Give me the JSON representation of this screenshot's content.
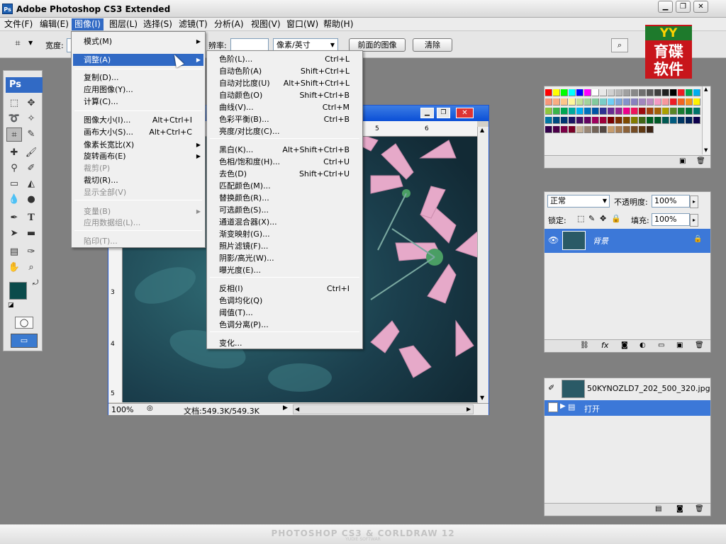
{
  "app": {
    "title": "Adobe Photoshop CS3 Extended",
    "icon_label": "Ps"
  },
  "menubar": [
    {
      "label": "文件(F)"
    },
    {
      "label": "编辑(E)"
    },
    {
      "label": "图像(I)"
    },
    {
      "label": "图层(L)"
    },
    {
      "label": "选择(S)"
    },
    {
      "label": "滤镜(T)"
    },
    {
      "label": "分析(A)"
    },
    {
      "label": "视图(V)"
    },
    {
      "label": "窗口(W)"
    },
    {
      "label": "帮助(H)"
    }
  ],
  "options_bar": {
    "width_label": "宽度:",
    "resolution_label": "辨率:",
    "resolution_unit": "像素/英寸",
    "front_image_button": "前面的图像",
    "clear_button": "清除"
  },
  "logo": {
    "text": "育碟软件",
    "mark": "YY"
  },
  "toolbox": {
    "badge": "Ps",
    "fg_color": "#0b4b4b",
    "bg_color": "#000000"
  },
  "image_menu": {
    "items": [
      {
        "label": "模式(M)",
        "submenu": true
      },
      {
        "label": "调整(A)",
        "submenu": true,
        "highlighted": true
      },
      {
        "label": "复制(D)..."
      },
      {
        "label": "应用图像(Y)..."
      },
      {
        "label": "计算(C)..."
      },
      {
        "label": "图像大小(I)...",
        "shortcut": "Alt+Ctrl+I"
      },
      {
        "label": "画布大小(S)...",
        "shortcut": "Alt+Ctrl+C"
      },
      {
        "label": "像素长宽比(X)",
        "submenu": true
      },
      {
        "label": "旋转画布(E)",
        "submenu": true
      },
      {
        "label": "裁剪(P)",
        "disabled": true
      },
      {
        "label": "裁切(R)..."
      },
      {
        "label": "显示全部(V)",
        "disabled": true
      },
      {
        "label": "变量(B)",
        "submenu": true,
        "disabled": true
      },
      {
        "label": "应用数据组(L)...",
        "disabled": true
      },
      {
        "label": "陷印(T)...",
        "disabled": true
      }
    ]
  },
  "adjust_menu": {
    "items": [
      {
        "label": "色阶(L)...",
        "shortcut": "Ctrl+L"
      },
      {
        "label": "自动色阶(A)",
        "shortcut": "Shift+Ctrl+L"
      },
      {
        "label": "自动对比度(U)",
        "shortcut": "Alt+Shift+Ctrl+L"
      },
      {
        "label": "自动颜色(O)",
        "shortcut": "Shift+Ctrl+B"
      },
      {
        "label": "曲线(V)...",
        "shortcut": "Ctrl+M"
      },
      {
        "label": "色彩平衡(B)...",
        "shortcut": "Ctrl+B"
      },
      {
        "label": "亮度/对比度(C)..."
      },
      {
        "label": "黑白(K)...",
        "shortcut": "Alt+Shift+Ctrl+B"
      },
      {
        "label": "色相/饱和度(H)...",
        "shortcut": "Ctrl+U"
      },
      {
        "label": "去色(D)",
        "shortcut": "Shift+Ctrl+U"
      },
      {
        "label": "匹配颜色(M)..."
      },
      {
        "label": "替换颜色(R)..."
      },
      {
        "label": "可选颜色(S)..."
      },
      {
        "label": "通道混合器(X)..."
      },
      {
        "label": "渐变映射(G)..."
      },
      {
        "label": "照片滤镜(F)..."
      },
      {
        "label": "阴影/高光(W)..."
      },
      {
        "label": "曝光度(E)..."
      },
      {
        "label": "反相(I)",
        "shortcut": "Ctrl+I"
      },
      {
        "label": "色调均化(Q)"
      },
      {
        "label": "阈值(T)..."
      },
      {
        "label": "色调分离(P)..."
      },
      {
        "label": "变化..."
      }
    ]
  },
  "document": {
    "zoom": "100%",
    "status": "文档:549.3K/549.3K",
    "ruler_top": [
      "5",
      "6"
    ],
    "ruler_left": [
      "3",
      "4",
      "5"
    ]
  },
  "layers_panel": {
    "blend_mode": "正常",
    "opacity_label": "不透明度:",
    "opacity_value": "100%",
    "lock_label": "锁定:",
    "fill_label": "填充:",
    "fill_value": "100%",
    "layer_name": "背景"
  },
  "history_panel": {
    "snapshot_name": "50KYNOZLD7_202_500_320.jpg",
    "step_name": "打开"
  },
  "footer": {
    "text": "PHOTOSHOP CS3 & CORLDRAW 12",
    "sub": "YUDIE SOFTWAR"
  },
  "swatch_colors": [
    "#ff0000",
    "#ffff00",
    "#00ff00",
    "#00ffff",
    "#0000ff",
    "#ff00ff",
    "#ffffff",
    "#e8e8e8",
    "#d0d0d0",
    "#b8b8b8",
    "#a0a0a0",
    "#888888",
    "#707070",
    "#585858",
    "#404040",
    "#202020",
    "#000000",
    "#ec1c24",
    "#00a651",
    "#00aeef",
    "#f7977a",
    "#f9ad81",
    "#fdc68a",
    "#fff79a",
    "#c4df9b",
    "#a2d39c",
    "#82ca9d",
    "#7bcdc8",
    "#6ecff6",
    "#7ea7d8",
    "#8493ca",
    "#8882be",
    "#a187be",
    "#bc8dbf",
    "#f49ac2",
    "#f6989d",
    "#ee1d24",
    "#f26522",
    "#f7941d",
    "#fff200",
    "#8dc73f",
    "#39b54a",
    "#00a651",
    "#00a99d",
    "#00aeef",
    "#0072bc",
    "#0054a6",
    "#2e3192",
    "#662d91",
    "#92278f",
    "#ec008c",
    "#ed145b",
    "#9e0b0f",
    "#a0410d",
    "#a36209",
    "#aba000",
    "#598527",
    "#197b30",
    "#007236",
    "#00746b",
    "#0076a3",
    "#004b80",
    "#003471",
    "#1b1464",
    "#440e62",
    "#630460",
    "#9e005d",
    "#9e0039",
    "#790000",
    "#7b2e00",
    "#7d4900",
    "#827b00",
    "#406618",
    "#005e20",
    "#005826",
    "#005952",
    "#005b7f",
    "#003663",
    "#002157",
    "#0d004c",
    "#32004b",
    "#4b0049",
    "#7b0046",
    "#7a0026",
    "#c7b299",
    "#998675",
    "#736357",
    "#534741",
    "#c69c6d",
    "#a67c52",
    "#8c6239",
    "#754c24",
    "#603913",
    "#3c2415"
  ]
}
